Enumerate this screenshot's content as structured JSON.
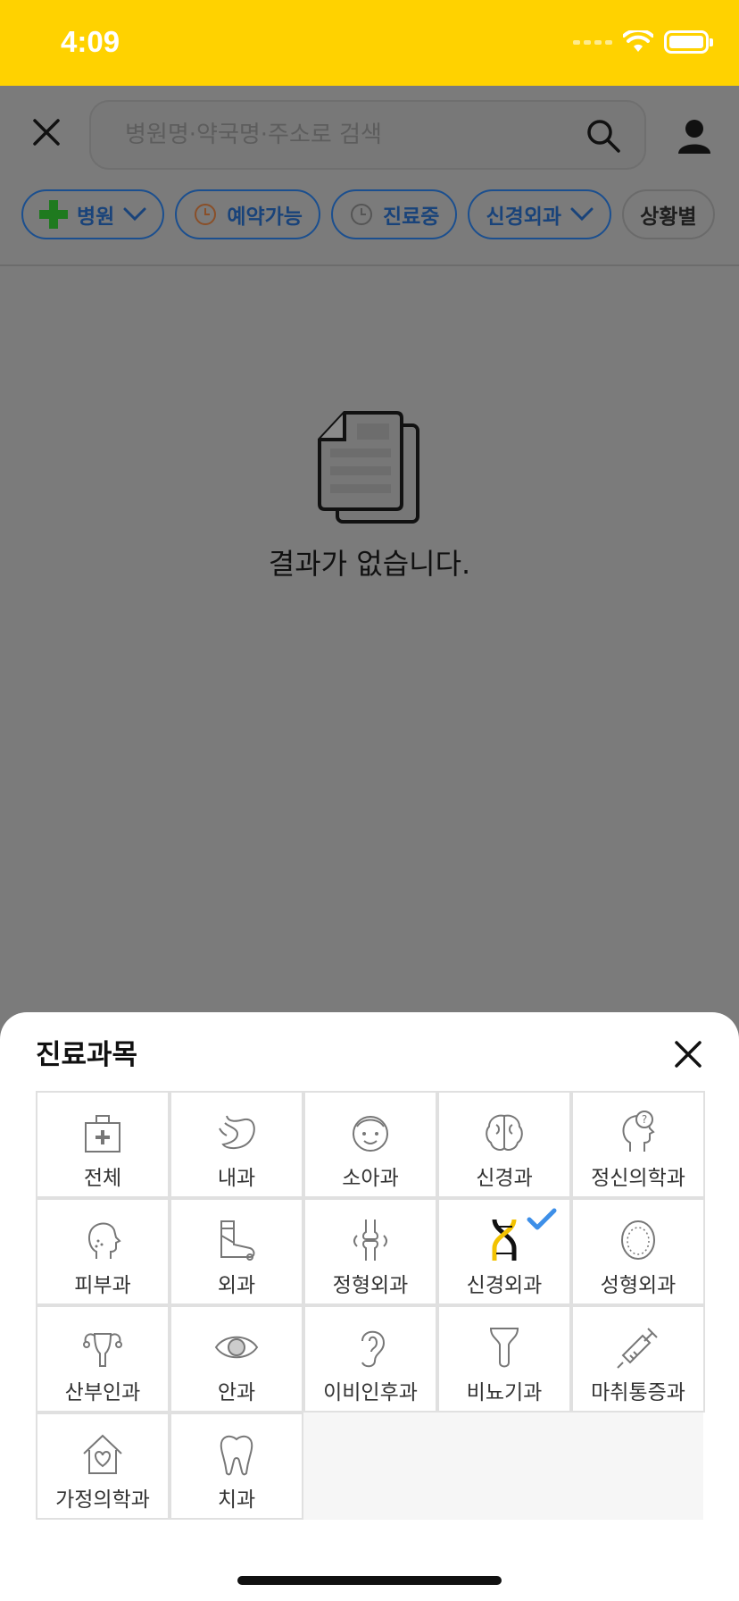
{
  "status_bar": {
    "time": "4:09"
  },
  "header": {
    "search_placeholder": "병원명·약국명·주소로 검색"
  },
  "chips": [
    {
      "label": "병원",
      "icon": "plus-icon"
    },
    {
      "label": "예약가능",
      "icon": "clock-icon"
    },
    {
      "label": "진료중",
      "icon": "clock-icon"
    },
    {
      "label": "신경외과",
      "icon": "chevron-down-icon"
    },
    {
      "label": "상황별"
    }
  ],
  "empty_state": {
    "message": "결과가 없습니다."
  },
  "sheet": {
    "title": "진료과목",
    "categories": [
      {
        "label": "전체",
        "icon": "hospital-icon",
        "selected": false
      },
      {
        "label": "내과",
        "icon": "stomach-icon",
        "selected": false
      },
      {
        "label": "소아과",
        "icon": "child-face-icon",
        "selected": false
      },
      {
        "label": "신경과",
        "icon": "brain-icon",
        "selected": false
      },
      {
        "label": "정신의학과",
        "icon": "head-question-icon",
        "selected": false
      },
      {
        "label": "피부과",
        "icon": "face-skin-icon",
        "selected": false
      },
      {
        "label": "외과",
        "icon": "cast-leg-icon",
        "selected": false
      },
      {
        "label": "정형외과",
        "icon": "bone-joint-icon",
        "selected": false
      },
      {
        "label": "신경외과",
        "icon": "dna-icon",
        "selected": true
      },
      {
        "label": "성형외과",
        "icon": "face-outline-icon",
        "selected": false
      },
      {
        "label": "산부인과",
        "icon": "uterus-icon",
        "selected": false
      },
      {
        "label": "안과",
        "icon": "eye-icon",
        "selected": false
      },
      {
        "label": "이비인후과",
        "icon": "ear-icon",
        "selected": false
      },
      {
        "label": "비뇨기과",
        "icon": "urology-icon",
        "selected": false
      },
      {
        "label": "마취통증과",
        "icon": "syringe-icon",
        "selected": false
      },
      {
        "label": "가정의학과",
        "icon": "house-heart-icon",
        "selected": false
      },
      {
        "label": "치과",
        "icon": "tooth-icon",
        "selected": false
      }
    ]
  },
  "colors": {
    "status_bar": "#ffd200",
    "overlay": "#7b7b7b",
    "check": "#3d8fe8",
    "chip_border": "#1b4f8f"
  }
}
